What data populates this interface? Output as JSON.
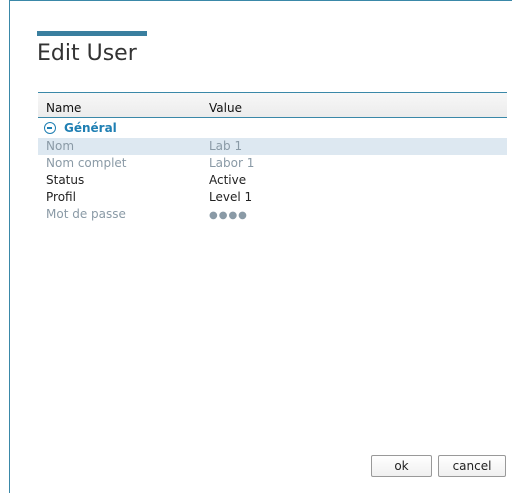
{
  "dialog": {
    "title": "Edit User"
  },
  "grid": {
    "columns": {
      "name": "Name",
      "value": "Value"
    },
    "group": {
      "label": "Général"
    },
    "rows": [
      {
        "name": "Nom",
        "value": "Lab 1"
      },
      {
        "name": "Nom complet",
        "value": "Labor 1"
      },
      {
        "name": "Status",
        "value": "Active"
      },
      {
        "name": "Profil",
        "value": "Level 1"
      },
      {
        "name": "Mot de passe",
        "value": "●●●●"
      }
    ]
  },
  "buttons": {
    "ok": "ok",
    "cancel": "cancel"
  },
  "colors": {
    "accent": "#3a7f9f",
    "group_text": "#1f7fb3",
    "selected_row": "#dde8f1",
    "dim_text": "#8a9aa6"
  }
}
